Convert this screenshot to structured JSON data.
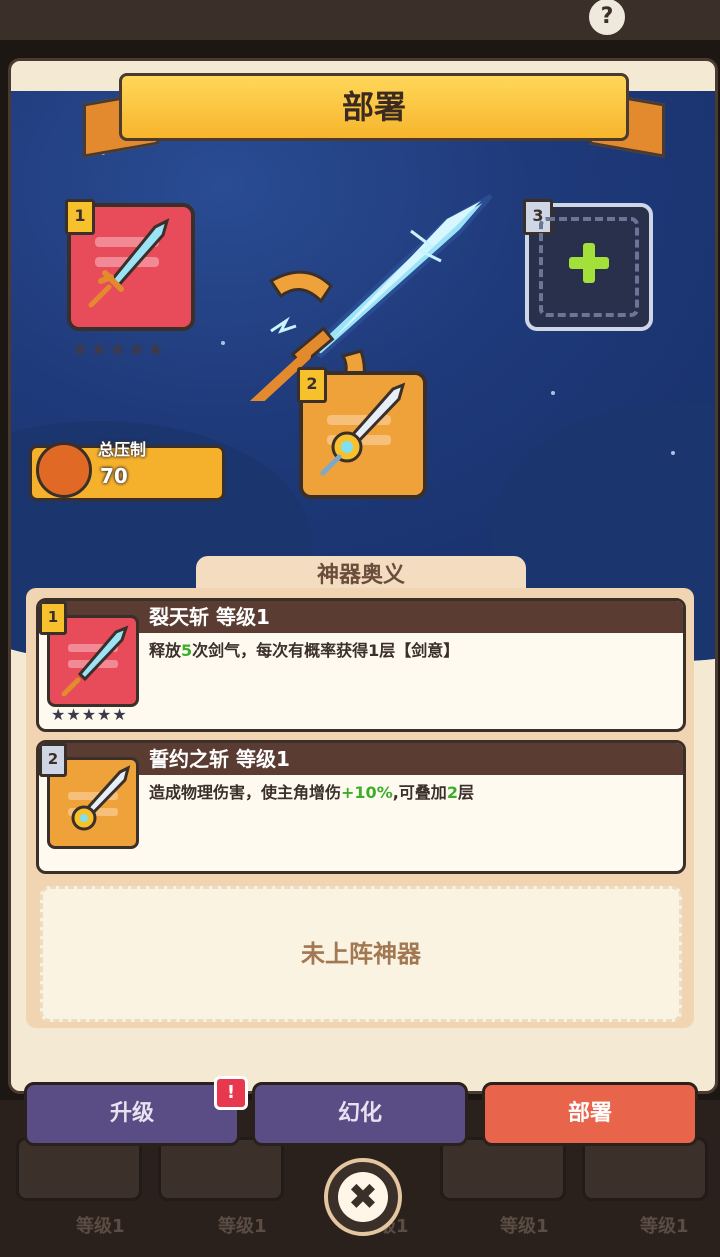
{
  "header": {
    "title": "部署",
    "help_label": "?"
  },
  "deploy": {
    "slots": [
      {
        "number": "1",
        "stars": "★★★★★",
        "color": "#e84b5a"
      },
      {
        "number": "2",
        "color": "#f0a23a"
      },
      {
        "number": "3",
        "empty": true
      }
    ],
    "power": {
      "label": "总压制",
      "value": "70"
    }
  },
  "artifacts": {
    "section_title": "神器奥义",
    "items": [
      {
        "number": "1",
        "title": "裂天斩 等级1",
        "desc_parts": [
          "释放",
          "5",
          "次剑气，每次有概率获得1层【剑意】"
        ],
        "stars": "★★★★★"
      },
      {
        "number": "2",
        "title": "誓约之斩 等级1",
        "desc_parts": [
          "造成物理伤害，使主角增伤",
          "+10%",
          ",可叠加",
          "2",
          "层"
        ]
      }
    ],
    "empty_label": "未上阵神器"
  },
  "tabs": [
    {
      "label": "升级",
      "badge": "!"
    },
    {
      "label": "幻化"
    },
    {
      "label": "部署",
      "active": true
    }
  ],
  "background_labels": [
    "等级1",
    "等级1",
    "等级1",
    "等级1",
    "等级1"
  ],
  "close_label": "✖"
}
